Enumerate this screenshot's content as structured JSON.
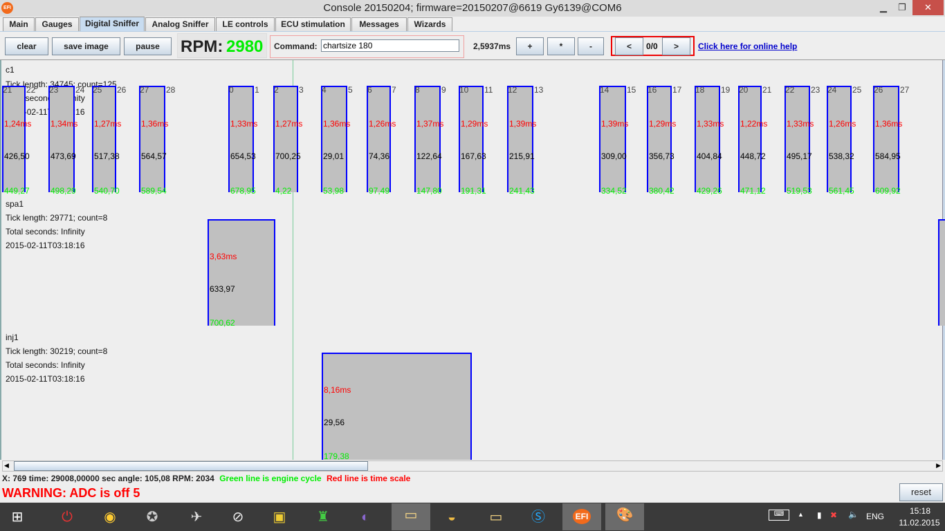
{
  "window": {
    "title": "Console 20150204; firmware=20150207@6619 Gy6139@COM6",
    "logo": "EFI",
    "minimize": "▁",
    "maximize": "❐",
    "close": "✕"
  },
  "tabs": [
    {
      "label": "Main"
    },
    {
      "label": "Gauges"
    },
    {
      "label": "Digital Sniffer",
      "active": true
    },
    {
      "label": "Analog Sniffer"
    },
    {
      "label": "LE controls"
    },
    {
      "label": "ECU stimulation"
    },
    {
      "label": "Messages"
    },
    {
      "label": "Wizards"
    }
  ],
  "toolbar": {
    "clear": "clear",
    "save_image": "save image",
    "pause": "pause",
    "rpm_label": "RPM:",
    "rpm_value": "2980",
    "command_label": "Command:",
    "command_value": "chartsize 180",
    "time_per_pixel": "2,5937ms",
    "zoom_in": "+",
    "zoom_reset": "*",
    "zoom_out": "-",
    "prev": "<",
    "page": "0/0",
    "next": ">",
    "help_link": "Click here for online help"
  },
  "colors": {
    "pulse_fill": "#c0c0c0",
    "pulse_border": "#0000ff",
    "duration": "#ff0000",
    "angle": "#000000",
    "angle2": "#00ee00",
    "engine_cycle_line": "#00cc00"
  },
  "channels": [
    {
      "name": "c1",
      "tick_length": "Tick length: 34745; count=125",
      "total": "Total seconds: Infinity",
      "timestamp": "2015-02-11T03:18:16",
      "pulses": [
        {
          "start": "21",
          "end": "22",
          "ms": "1,24ms",
          "angle": "426,50",
          "angle2": "449,27"
        },
        {
          "start": "23",
          "end": "24",
          "ms": "1,34ms",
          "angle": "473,69",
          "angle2": "498,29"
        },
        {
          "start": "25",
          "end": "26",
          "ms": "1,27ms",
          "angle": "517,38",
          "angle2": "540,70"
        },
        {
          "start": "27",
          "end": "28",
          "ms": "1,36ms",
          "angle": "564,57",
          "angle2": "589,54"
        },
        {
          "start": "0",
          "end": "1",
          "ms": "1,33ms",
          "angle": "654,53",
          "angle2": "678,95"
        },
        {
          "start": "2",
          "end": "3",
          "ms": "1,27ms",
          "angle": "700,25",
          "angle2": "4,22"
        },
        {
          "start": "4",
          "end": "5",
          "ms": "1,36ms",
          "angle": "29,01",
          "angle2": "53,98"
        },
        {
          "start": "6",
          "end": "7",
          "ms": "1,26ms",
          "angle": "74,36",
          "angle2": "97,49"
        },
        {
          "start": "8",
          "end": "9",
          "ms": "1,37ms",
          "angle": "122,64",
          "angle2": "147,80"
        },
        {
          "start": "10",
          "end": "11",
          "ms": "1,29ms",
          "angle": "167,63",
          "angle2": "191,31"
        },
        {
          "start": "12",
          "end": "13",
          "ms": "1,39ms",
          "angle": "215,91",
          "angle2": "241,43"
        },
        {
          "start": "14",
          "end": "15",
          "ms": "1,39ms",
          "angle": "309,00",
          "angle2": "334,52"
        },
        {
          "start": "16",
          "end": "17",
          "ms": "1,29ms",
          "angle": "356,73",
          "angle2": "380,42"
        },
        {
          "start": "18",
          "end": "19",
          "ms": "1,33ms",
          "angle": "404,84",
          "angle2": "429,26"
        },
        {
          "start": "20",
          "end": "21",
          "ms": "1,22ms",
          "angle": "448,72",
          "angle2": "471,12"
        },
        {
          "start": "22",
          "end": "23",
          "ms": "1,33ms",
          "angle": "495,17",
          "angle2": "519,53"
        },
        {
          "start": "24",
          "end": "25",
          "ms": "1,26ms",
          "angle": "538,32",
          "angle2": "561,45"
        },
        {
          "start": "26",
          "end": "27",
          "ms": "1,36ms",
          "angle": "584,95",
          "angle2": "609,92"
        }
      ]
    },
    {
      "name": "spa1",
      "tick_length": "Tick length: 29771; count=8",
      "total": "Total seconds: Infinity",
      "timestamp": "2015-02-11T03:18:16",
      "pulses": [
        {
          "ms": "3,63ms",
          "angle": "633,97",
          "angle2": "700,62"
        },
        {
          "ms": "",
          "angle": "",
          "angle2": ""
        }
      ]
    },
    {
      "name": "inj1",
      "tick_length": "Tick length: 30219; count=8",
      "total": "Total seconds: Infinity",
      "timestamp": "2015-02-11T03:18:16",
      "pulses": [
        {
          "ms": "8,16ms",
          "angle": "29,56",
          "angle2": "179,38"
        }
      ]
    }
  ],
  "status": {
    "readout": "X: 769 time: 29008,00000 sec angle: 105,08 RPM: 2034",
    "green_note": "Green line is engine cycle",
    "red_note": "Red line is time scale",
    "warning": "WARNING: ADC is off 5",
    "reset": "reset"
  },
  "taskbar": {
    "apps": [
      "windows-start",
      "power",
      "chrome",
      "world-of-tanks",
      "aircraft",
      "compass",
      "terminal",
      "creeper",
      "eclipse",
      "file-explorer",
      "bucket",
      "file-explorer-2",
      "skype",
      "efi-console",
      "paint"
    ],
    "efi_label": "EFI",
    "language": "ENG",
    "time": "15:18",
    "date": "11.02.2015"
  }
}
